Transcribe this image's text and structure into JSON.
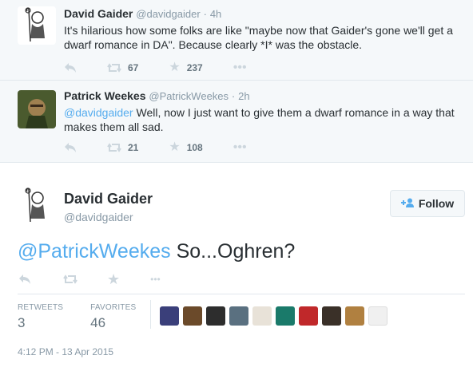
{
  "tweets": [
    {
      "name": "David Gaider",
      "handle": "@davidgaider",
      "sep": "·",
      "time": "4h",
      "text": "It's hilarious how some folks are like \"maybe now that Gaider's gone we'll get a dwarf romance in DA\". Because clearly *I* was the obstacle.",
      "retweets": "67",
      "favorites": "237"
    },
    {
      "name": "Patrick Weekes",
      "handle": "@PatrickWeekes",
      "sep": "·",
      "time": "2h",
      "mention": "@davidgaider",
      "text": " Well, now I just want to give them a dwarf romance in a way that makes them all sad.",
      "retweets": "21",
      "favorites": "108"
    }
  ],
  "main": {
    "name": "David Gaider",
    "handle": "@davidgaider",
    "follow_label": "Follow",
    "mention": "@PatrickWeekes",
    "text": " So...Oghren?",
    "retweets_label": "RETWEETS",
    "retweets": "3",
    "favorites_label": "FAVORITES",
    "favorites": "46",
    "timestamp": "4:12 PM - 13 Apr 2015"
  },
  "icons": {
    "reply": "reply-icon",
    "retweet": "retweet-icon",
    "favorite": "star-icon",
    "more": "more-icon",
    "follow": "add-user-icon"
  },
  "colors": {
    "accent": "#55acee",
    "muted": "#8899a6",
    "text": "#292f33",
    "thread_bg": "#f5f8fa"
  },
  "favoriters_count_shown": 10
}
